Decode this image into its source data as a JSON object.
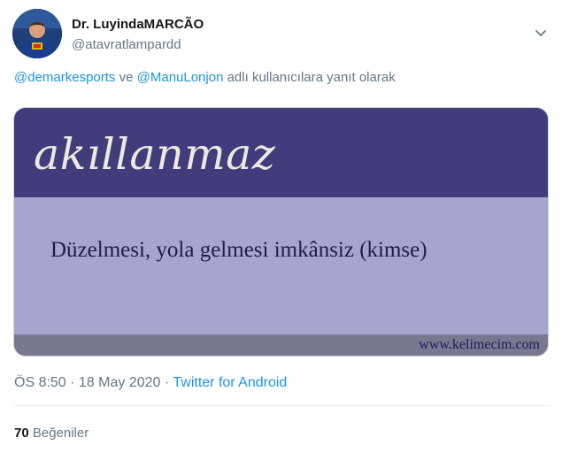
{
  "author": {
    "name": "Dr. LuyindaMARCÃO",
    "handle": "@atavratlampardd"
  },
  "reply": {
    "mention_1": "@demarkesports",
    "connector": " ve ",
    "mention_2": "@ManuLonjon",
    "suffix": " adlı kullanıcılara yanıt olarak"
  },
  "card": {
    "word": "akıllanmaz",
    "definition": "Düzelmesi, yola gelmesi imkânsiz (kimse)",
    "url": "www.kelimecim.com",
    "colors": {
      "header": "#413c7c",
      "body": "#a5a5cf",
      "footer": "#78788f"
    }
  },
  "meta": {
    "time": "ÖS 8:50",
    "separator_1": " · ",
    "date": "18 May 2020",
    "separator_2": " · ",
    "source": "Twitter for Android"
  },
  "stats": {
    "likes_count": "70",
    "likes_label": " Beğeniler"
  },
  "icons": {
    "menu": "chevron-down-icon",
    "avatar": "avatar"
  },
  "colors": {
    "link": "#1b95e0",
    "secondary_text": "#657786",
    "primary_text": "#14171a"
  }
}
